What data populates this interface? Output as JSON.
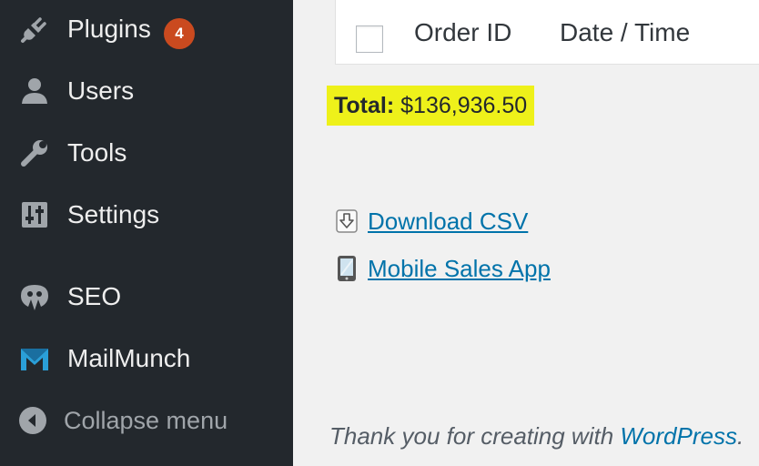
{
  "sidebar": {
    "items": [
      {
        "label": "Plugins",
        "icon": "plugin-icon",
        "badge": "4"
      },
      {
        "label": "Users",
        "icon": "users-icon"
      },
      {
        "label": "Tools",
        "icon": "wrench-icon"
      },
      {
        "label": "Settings",
        "icon": "settings-sliders-icon"
      },
      {
        "label": "SEO",
        "icon": "seo-icon"
      },
      {
        "label": "MailMunch",
        "icon": "mailmunch-icon"
      }
    ],
    "collapse_label": "Collapse menu"
  },
  "table": {
    "columns": [
      "Order ID",
      "Date / Time"
    ]
  },
  "summary": {
    "total_label": "Total:",
    "total_value": "$136,936.50"
  },
  "links": {
    "download_csv": "Download CSV",
    "mobile_app": "Mobile Sales App"
  },
  "footer": {
    "text": "Thank you for creating with ",
    "link": "WordPress",
    "suffix": "."
  },
  "colors": {
    "sidebar_bg": "#23282d",
    "badge": "#ca4a1f",
    "highlight": "#eef11a",
    "link": "#0073aa"
  }
}
